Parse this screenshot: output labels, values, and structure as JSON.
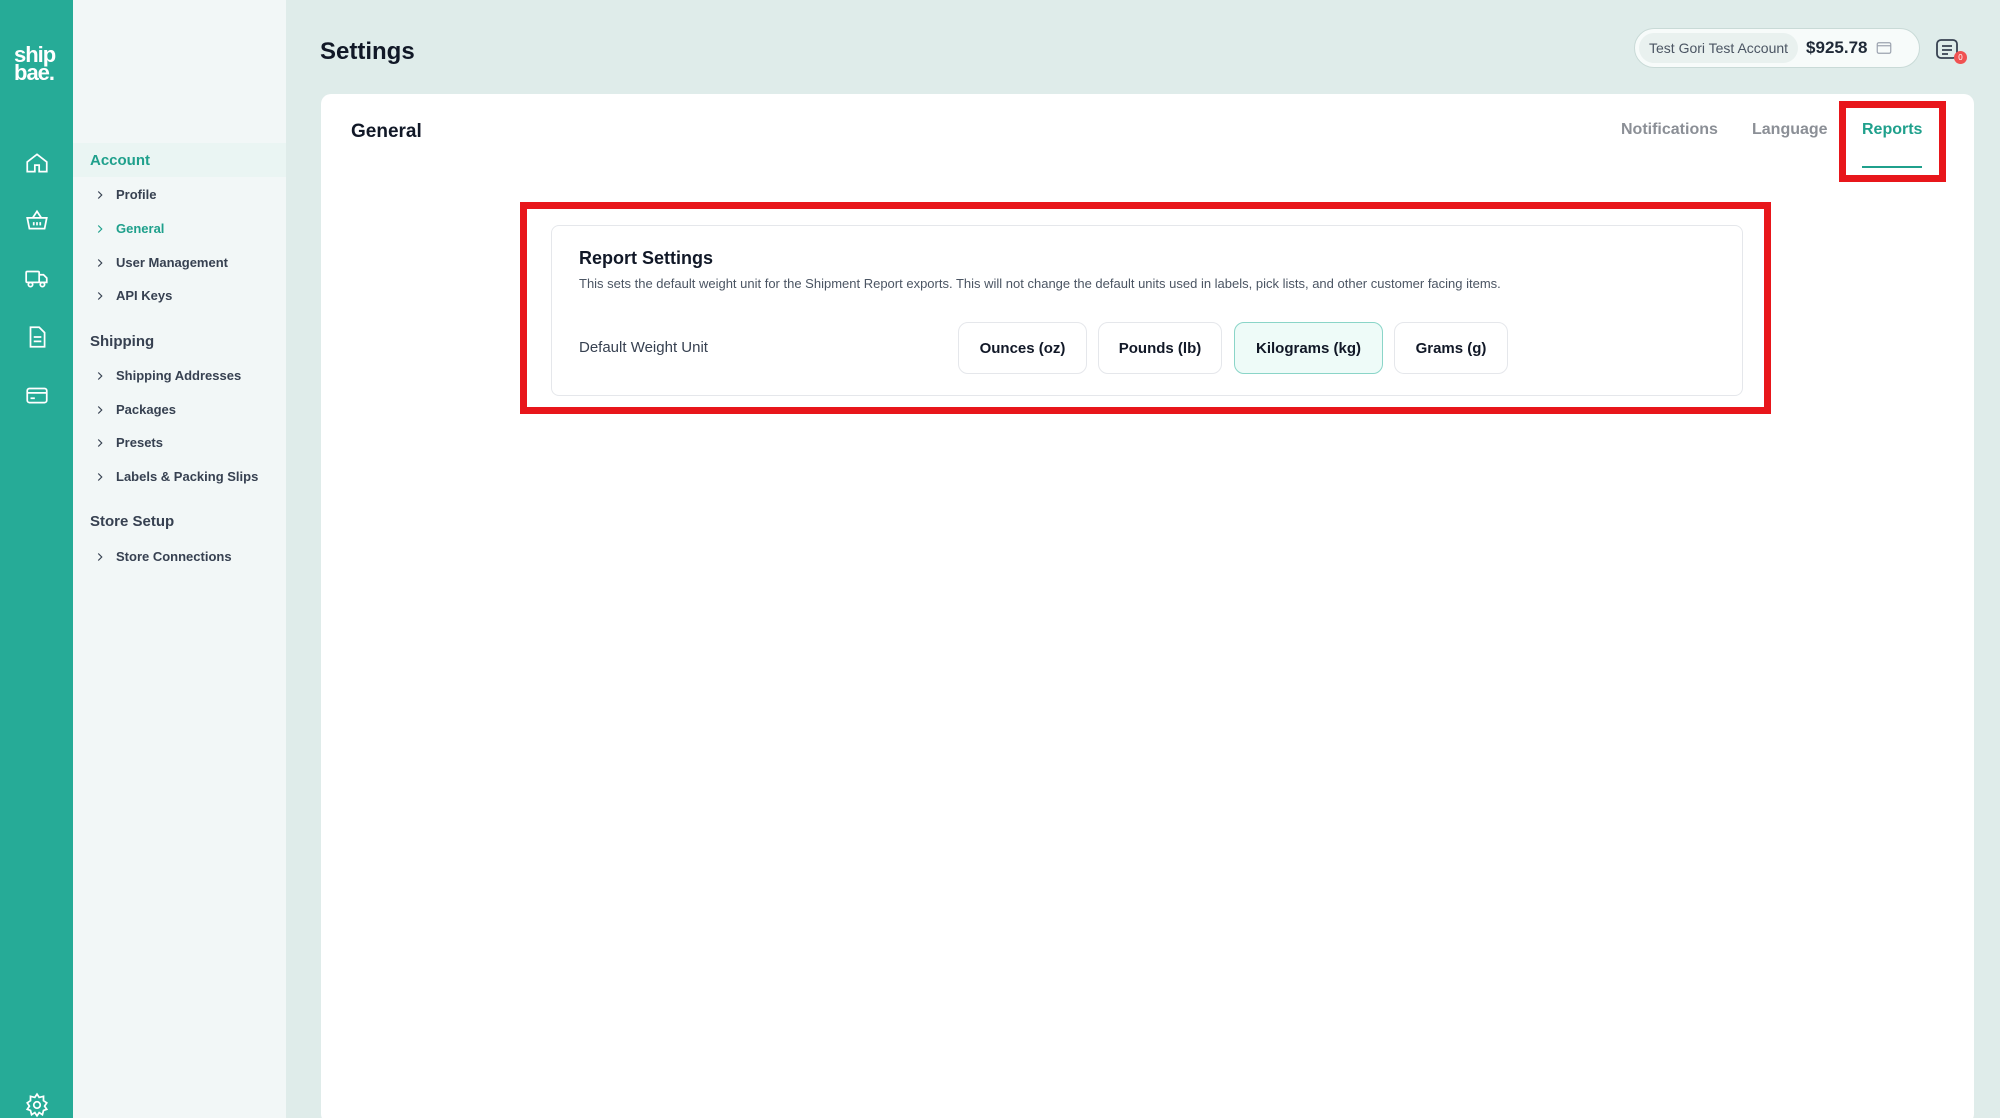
{
  "brand": {
    "logo_line1": "ship",
    "logo_line2": "bae."
  },
  "rail": {
    "icons": [
      "home-icon",
      "basket-icon",
      "truck-icon",
      "document-icon",
      "card-icon",
      "gear-icon"
    ]
  },
  "header": {
    "title": "Settings",
    "account_name": "Test Gori Test Account",
    "balance": "$925.78",
    "notification_count": "0"
  },
  "sidebar": {
    "groups": [
      {
        "label": "Account",
        "items": [
          "Profile",
          "General",
          "User Management",
          "API Keys"
        ]
      },
      {
        "label": "Shipping",
        "items": [
          "Shipping Addresses",
          "Packages",
          "Presets",
          "Labels & Packing Slips"
        ]
      },
      {
        "label": "Store Setup",
        "items": [
          "Store Connections"
        ]
      }
    ],
    "active_item": "General"
  },
  "panel": {
    "title": "General",
    "tabs": [
      "Notifications",
      "Language",
      "Reports"
    ],
    "active_tab": "Reports"
  },
  "report_settings": {
    "title": "Report Settings",
    "description": "This sets the default weight unit for the Shipment Report exports. This will not change the default units used in labels, pick lists, and other customer facing items.",
    "field_label": "Default Weight Unit",
    "units": [
      "Ounces (oz)",
      "Pounds (lb)",
      "Kilograms (kg)",
      "Grams (g)"
    ],
    "selected_unit": "Kilograms (kg)"
  },
  "colors": {
    "brand": "#26ab97",
    "accent": "#1fa08c",
    "highlight": "#e8161b"
  }
}
